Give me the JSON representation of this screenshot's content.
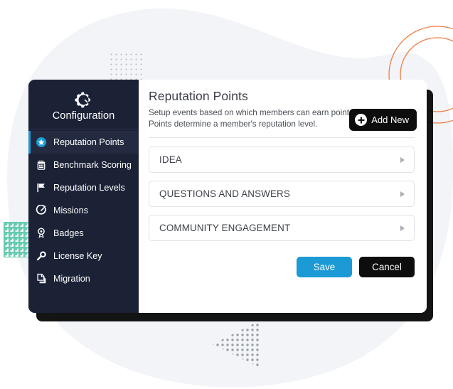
{
  "sidebar": {
    "brand": {
      "label": "Configuration",
      "icon": "gear-wrench-icon"
    },
    "items": [
      {
        "label": "Reputation Points",
        "icon": "star-badge-icon",
        "active": true
      },
      {
        "label": "Benchmark Scoring",
        "icon": "scoreboard-icon",
        "active": false
      },
      {
        "label": "Reputation Levels",
        "icon": "flag-icon",
        "active": false
      },
      {
        "label": "Missions",
        "icon": "target-arrow-icon",
        "active": false
      },
      {
        "label": "Badges",
        "icon": "award-medal-icon",
        "active": false
      },
      {
        "label": "License Key",
        "icon": "wrench-key-icon",
        "active": false
      },
      {
        "label": "Migration",
        "icon": "copy-stack-icon",
        "active": false
      }
    ]
  },
  "panel": {
    "title": "Reputation Points",
    "description": "Setup events based on which members can earn points. Points determine a member's reputation level.",
    "add_new_label": "Add New",
    "add_new_icon": "plus-circle-icon",
    "sections": [
      {
        "label": "IDEA",
        "expand_icon": "chevron-right-icon"
      },
      {
        "label": "QUESTIONS AND ANSWERS",
        "expand_icon": "chevron-right-icon"
      },
      {
        "label": "COMMUNITY ENGAGEMENT",
        "expand_icon": "chevron-right-icon"
      }
    ],
    "save_label": "Save",
    "cancel_label": "Cancel"
  },
  "theme": {
    "sidebar_bg": "#1b2236",
    "sidebar_active_bg": "#242b40",
    "accent_blue": "#2196d3",
    "save_blue": "#1b9ad6",
    "dark_button": "#0d0d0d",
    "blob_gray": "#f2f4f8",
    "dots_gray": "#b9bcc4",
    "dots_green": "#5fc9ac",
    "circles_orange": "#ef7f45"
  }
}
